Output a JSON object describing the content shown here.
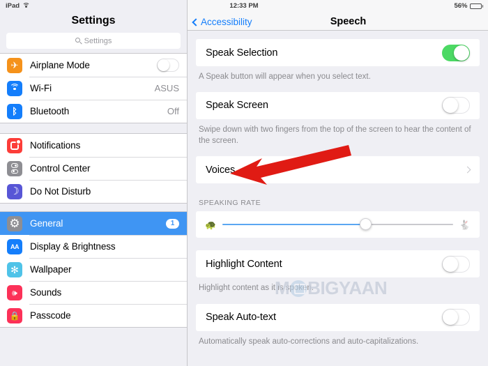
{
  "statusbar": {
    "device": "iPad",
    "wifi_icon": "wifi-icon",
    "time": "12:33 PM",
    "battery_percent": "56%",
    "battery_icon": "battery-icon"
  },
  "sidebar": {
    "title": "Settings",
    "search": {
      "placeholder": "Settings",
      "icon": "search-icon"
    },
    "groups": [
      {
        "items": [
          {
            "label": "Airplane Mode",
            "icon": "airplane-icon",
            "color": "#F5921B",
            "control": "toggle",
            "toggle_on": false
          },
          {
            "label": "Wi-Fi",
            "icon": "wifi-icon",
            "color": "#147EFB",
            "control": "value",
            "value": "ASUS"
          },
          {
            "label": "Bluetooth",
            "icon": "bluetooth-icon",
            "color": "#147EFB",
            "control": "value",
            "value": "Off"
          }
        ]
      },
      {
        "items": [
          {
            "label": "Notifications",
            "icon": "notifications-icon",
            "color": "#FC3D39",
            "control": "none"
          },
          {
            "label": "Control Center",
            "icon": "control-center-icon",
            "color": "#8E8E93",
            "control": "none"
          },
          {
            "label": "Do Not Disturb",
            "icon": "moon-icon",
            "color": "#5856D6",
            "control": "none"
          }
        ]
      },
      {
        "items": [
          {
            "label": "General",
            "icon": "gear-icon",
            "color": "#8E8E93",
            "control": "badge",
            "badge": "1",
            "selected": true
          },
          {
            "label": "Display & Brightness",
            "icon": "display-brightness-icon",
            "color": "#147EFB",
            "control": "none"
          },
          {
            "label": "Wallpaper",
            "icon": "wallpaper-icon",
            "color": "#4FC3E8",
            "control": "none"
          },
          {
            "label": "Sounds",
            "icon": "sounds-icon",
            "color": "#FC3158",
            "control": "none"
          },
          {
            "label": "Passcode",
            "icon": "passcode-icon",
            "color": "#FC3158",
            "control": "none"
          }
        ]
      }
    ]
  },
  "main": {
    "back_label": "Accessibility",
    "back_icon": "chevron-left-icon",
    "title": "Speech",
    "rows": {
      "speak_selection": {
        "label": "Speak Selection",
        "toggle_on": true,
        "description": "A Speak button will appear when you select text."
      },
      "speak_screen": {
        "label": "Speak Screen",
        "toggle_on": false,
        "description": "Swipe down with two fingers from the top of the screen to hear the content of the screen."
      },
      "voices": {
        "label": "Voices",
        "chevron": "chevron-right-icon"
      },
      "speaking_rate": {
        "header": "SPEAKING RATE",
        "left_icon": "tortoise-icon",
        "right_icon": "hare-icon",
        "value_percent": 62
      },
      "highlight_content": {
        "label": "Highlight Content",
        "toggle_on": false,
        "description": "Highlight content as it is spoken."
      },
      "speak_auto_text": {
        "label": "Speak Auto-text",
        "toggle_on": false,
        "description": "Automatically speak auto-corrections and auto-capitalizations."
      }
    }
  },
  "overlay": {
    "arrow": {
      "name": "red-arrow-annotation",
      "color": "#E01B14"
    },
    "watermark": {
      "text_before": "M",
      "text_after": "BIGYAAN"
    }
  },
  "colors": {
    "accent_blue": "#147EFB",
    "selected_row": "#3F95F3",
    "toggle_on": "#4CD964",
    "panel_bg": "#EFEFF4"
  }
}
